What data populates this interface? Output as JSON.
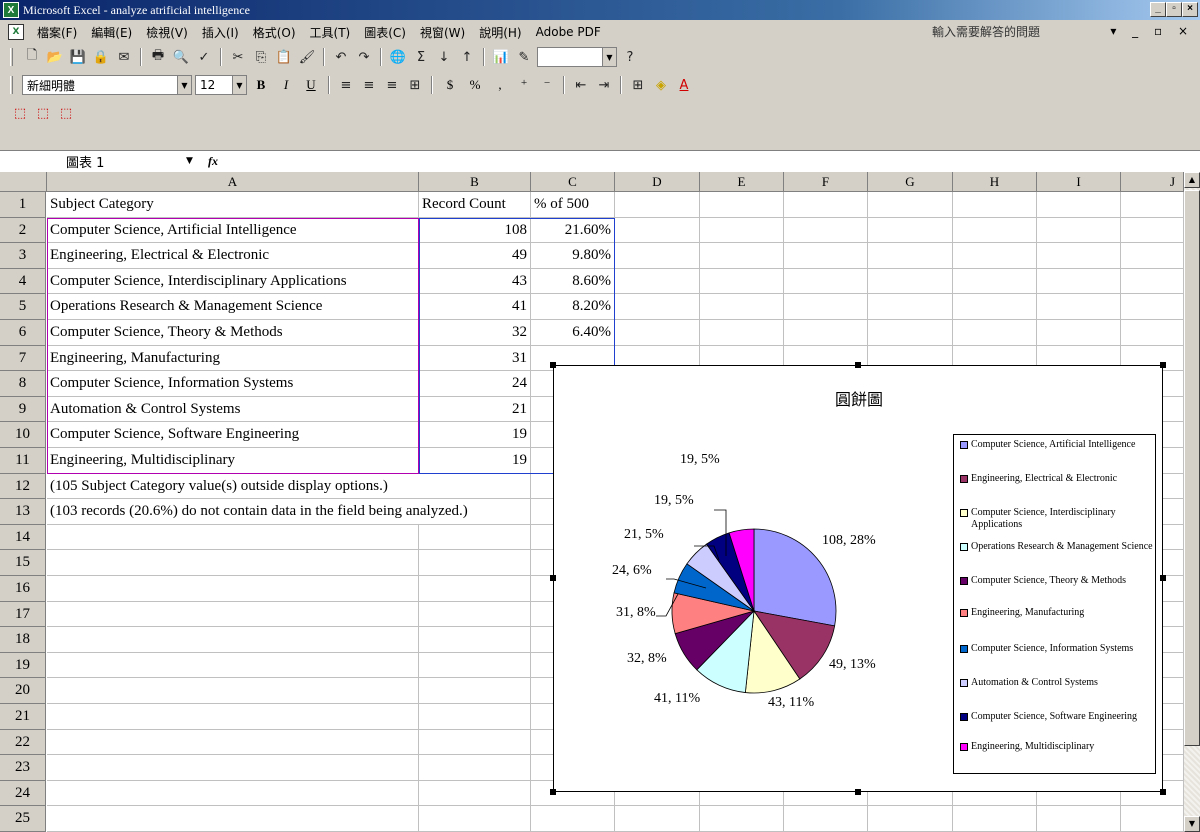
{
  "window": {
    "title": "Microsoft Excel - analyze atrificial intelligence",
    "minimize": "_",
    "restore": "▫",
    "close": "×"
  },
  "menu": {
    "items": [
      "檔案(F)",
      "編輯(E)",
      "檢視(V)",
      "插入(I)",
      "格式(O)",
      "工具(T)",
      "圖表(C)",
      "視窗(W)",
      "說明(H)",
      "Adobe PDF"
    ],
    "help_placeholder": "輸入需要解答的問題",
    "right_controls": "▾ _ ▫ ×"
  },
  "toolbar": {
    "font_name": "新細明體",
    "font_size": "12",
    "bold": "B",
    "italic": "I",
    "underline": "U",
    "currency": "$",
    "percent": "%",
    "comma": ","
  },
  "formula_bar": {
    "name_box": "圖表 1",
    "fx": "fx",
    "formula": ""
  },
  "sheet": {
    "columns": [
      "A",
      "B",
      "C",
      "D",
      "E",
      "F",
      "G",
      "H",
      "I",
      "J"
    ],
    "rows": [
      "1",
      "2",
      "3",
      "4",
      "5",
      "6",
      "7",
      "8",
      "9",
      "10",
      "11",
      "12",
      "13",
      "14",
      "15",
      "16",
      "17",
      "18",
      "19",
      "20",
      "21",
      "22",
      "23",
      "24",
      "25"
    ],
    "header": {
      "a": "Subject Category",
      "b": "Record Count",
      "c": "% of 500"
    },
    "data": [
      {
        "a": "Computer Science, Artificial Intelligence",
        "b": "108",
        "c": "21.60%"
      },
      {
        "a": "Engineering, Electrical & Electronic",
        "b": "49",
        "c": "9.80%"
      },
      {
        "a": "Computer Science, Interdisciplinary Applications",
        "b": "43",
        "c": "8.60%"
      },
      {
        "a": "Operations Research & Management Science",
        "b": "41",
        "c": "8.20%"
      },
      {
        "a": "Computer Science, Theory & Methods",
        "b": "32",
        "c": "6.40%"
      },
      {
        "a": "Engineering, Manufacturing",
        "b": "31",
        "c": ""
      },
      {
        "a": "Computer Science, Information Systems",
        "b": "24",
        "c": ""
      },
      {
        "a": "Automation & Control Systems",
        "b": "21",
        "c": ""
      },
      {
        "a": "Computer Science, Software Engineering",
        "b": "19",
        "c": ""
      },
      {
        "a": "Engineering, Multidisciplinary",
        "b": "19",
        "c": ""
      }
    ],
    "note1": "(105 Subject Category value(s) outside display options.)",
    "note2": "(103 records (20.6%) do not contain data in the field being analyzed.)"
  },
  "chart_data": {
    "type": "pie",
    "title": "圓餅圖",
    "categories": [
      "Computer Science, Artificial Intelligence",
      "Engineering, Electrical & Electronic",
      "Computer Science, Interdisciplinary Applications",
      "Operations Research & Management Science",
      "Computer Science, Theory & Methods",
      "Engineering, Manufacturing",
      "Computer Science, Information Systems",
      "Automation & Control Systems",
      "Computer Science, Software Engineering",
      "Engineering, Multidisciplinary"
    ],
    "values": [
      108,
      49,
      43,
      41,
      32,
      31,
      24,
      21,
      19,
      19
    ],
    "data_labels": [
      "108, 28%",
      "49, 13%",
      "43, 11%",
      "41, 11%",
      "32, 8%",
      "31, 8%",
      "24, 6%",
      "21, 5%",
      "19, 5%",
      "19, 5%"
    ],
    "colors": [
      "#9999ff",
      "#993366",
      "#ffffcc",
      "#ccffff",
      "#660066",
      "#ff8080",
      "#0066cc",
      "#ccccff",
      "#000080",
      "#ff00ff"
    ],
    "legend_items": [
      "Computer Science, Artificial Intelligence",
      "Engineering, Electrical & Electronic",
      "Computer Science, Interdisciplinary Applications",
      "Operations Research & Management Science",
      "Computer Science, Theory & Methods",
      "Engineering, Manufacturing",
      "Computer Science, Information Systems",
      "Automation & Control Systems",
      "Computer Science, Software Engineering",
      "Engineering, Multidisciplinary"
    ],
    "legend_placement": "right"
  }
}
